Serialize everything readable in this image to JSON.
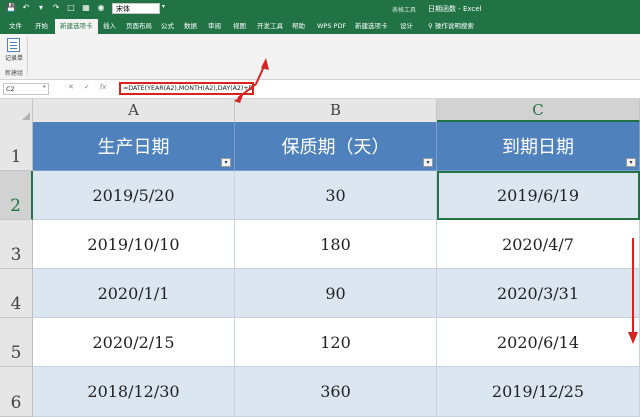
{
  "titlebar": {
    "font_name": "宋体",
    "context_tools": "表格工具",
    "doc_title": "日期函数 - Excel"
  },
  "tabs": [
    {
      "label": "文件"
    },
    {
      "label": "开始"
    },
    {
      "label": "新建选项卡",
      "active": true
    },
    {
      "label": "插入"
    },
    {
      "label": "页面布局"
    },
    {
      "label": "公式"
    },
    {
      "label": "数据"
    },
    {
      "label": "审阅"
    },
    {
      "label": "视图"
    },
    {
      "label": "开发工具"
    },
    {
      "label": "帮助"
    },
    {
      "label": "WPS PDF"
    },
    {
      "label": "新建选项卡"
    },
    {
      "label": "设计"
    }
  ],
  "help_search": "操作说明搜索",
  "ribbon": {
    "button_label": "记录单",
    "group_label": "新建组"
  },
  "formula_bar": {
    "name_box": "C2",
    "formula": "=DATE(YEAR(A2),MONTH(A2),DAY(A2)+B2)"
  },
  "columns": [
    "A",
    "B",
    "C"
  ],
  "rows": [
    "1",
    "2",
    "3",
    "4",
    "5",
    "6"
  ],
  "table": {
    "headers": [
      "生产日期",
      "保质期（天）",
      "到期日期"
    ],
    "rows": [
      [
        "2019/5/20",
        "30",
        "2019/6/19"
      ],
      [
        "2019/10/10",
        "180",
        "2020/4/7"
      ],
      [
        "2020/1/1",
        "90",
        "2020/3/31"
      ],
      [
        "2020/2/15",
        "120",
        "2020/6/14"
      ],
      [
        "2018/12/30",
        "360",
        "2019/12/25"
      ]
    ]
  },
  "selected_cell": "C2",
  "colors": {
    "excel_green": "#217346",
    "header_fill": "#4f81bd",
    "band_fill": "#dce6f1",
    "annotation_red": "#d9231e"
  }
}
